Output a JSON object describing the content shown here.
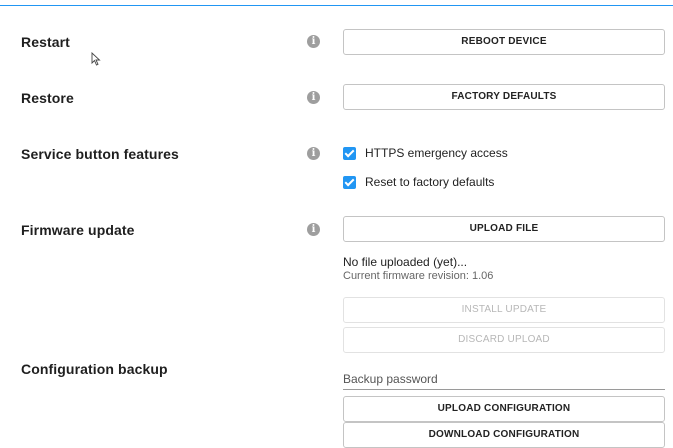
{
  "sections": {
    "restart": {
      "label": "Restart",
      "button": "REBOOT DEVICE"
    },
    "restore": {
      "label": "Restore",
      "button": "FACTORY DEFAULTS"
    },
    "service": {
      "label": "Service button features",
      "options": [
        {
          "label": "HTTPS emergency access",
          "checked": true
        },
        {
          "label": "Reset to factory defaults",
          "checked": true
        }
      ]
    },
    "firmware": {
      "label": "Firmware update",
      "upload_button": "UPLOAD FILE",
      "status": "No file uploaded (yet)...",
      "revision": "Current firmware revision: 1.06",
      "install_button": "INSTALL UPDATE",
      "discard_button": "DISCARD UPLOAD"
    },
    "backup": {
      "label": "Configuration backup",
      "password_placeholder": "Backup password",
      "upload_button": "UPLOAD CONFIGURATION",
      "download_button": "DOWNLOAD CONFIGURATION"
    }
  },
  "icons": {
    "info": "info-icon",
    "checkbox": "check-icon",
    "cursor": "mouse-pointer-icon"
  },
  "colors": {
    "accent": "#2196f3",
    "info_icon": "#9e9e9e",
    "disabled_text": "#b7b7b7"
  }
}
